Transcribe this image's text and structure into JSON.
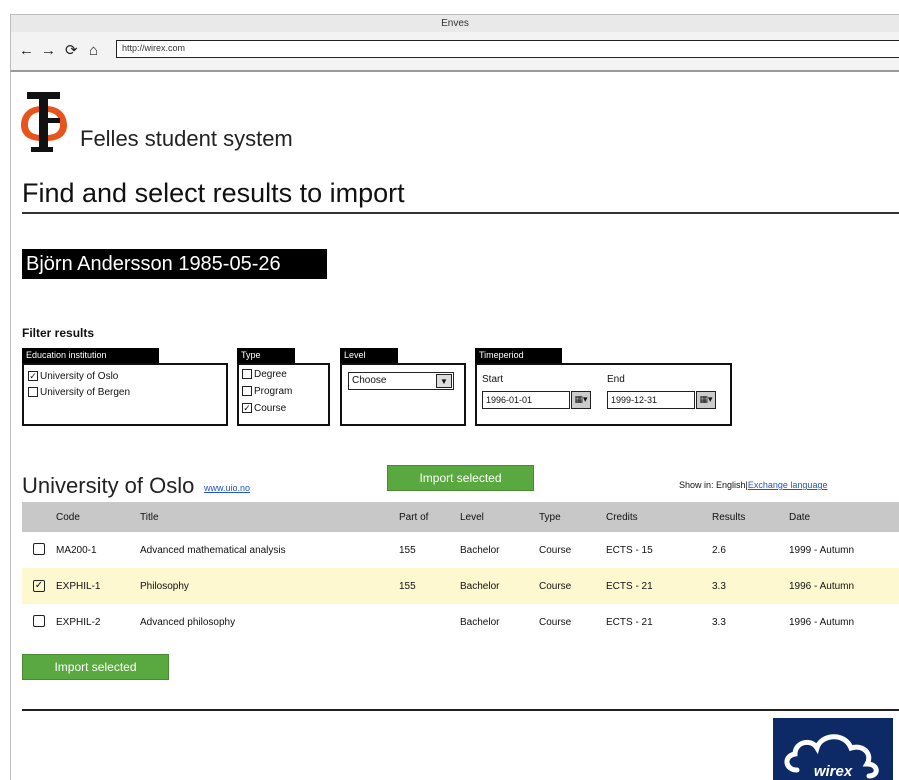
{
  "window": {
    "title": "Enves"
  },
  "browser": {
    "url": "http://wirex.com",
    "back": "←",
    "forward": "→",
    "reload": "⟳",
    "home": "⌂"
  },
  "header": {
    "app_name": "Felles student system",
    "page_title": "Find and select results to import",
    "student": "Björn Andersson 1985-05-26"
  },
  "filters": {
    "heading": "Filter results",
    "institution": {
      "label": "Education institution",
      "options": [
        {
          "label": "University of Oslo",
          "mark": "✓"
        },
        {
          "label": "University of Bergen",
          "mark": ""
        }
      ]
    },
    "type": {
      "label": "Type",
      "options": [
        {
          "label": "Degree",
          "mark": ""
        },
        {
          "label": "Program",
          "mark": ""
        },
        {
          "label": "Course",
          "mark": "✓"
        }
      ]
    },
    "level": {
      "label": "Level",
      "selected": "Choose",
      "arrow": "▼"
    },
    "timeperiod": {
      "label": "Timeperiod",
      "start_label": "Start",
      "start_value": "1996-01-01",
      "end_label": "End",
      "end_value": "1999-12-31",
      "spin": "▦▾"
    }
  },
  "results": {
    "institution_name": "University of Oslo",
    "institution_link": "www.uio.no",
    "import_label": "Import selected",
    "show_in_label": "Show in: English",
    "separator": "|",
    "exchange_link": "Exchange language",
    "columns": [
      "Code",
      "Title",
      "Part of",
      "Level",
      "Type",
      "Credits",
      "Results",
      "Date"
    ],
    "rows": [
      {
        "mark": "",
        "code": "MA200-1",
        "title": "Advanced mathematical analysis",
        "part_of": "155",
        "level": "Bachelor",
        "type": "Course",
        "credits": "ECTS - 15",
        "result": "2.6",
        "date": "1999 - Autumn"
      },
      {
        "mark": "✓",
        "code": "EXPHIL-1",
        "title": "Philosophy",
        "part_of": "155",
        "level": "Bachelor",
        "type": "Course",
        "credits": "ECTS - 21",
        "result": "3.3",
        "date": "1996 - Autumn"
      },
      {
        "mark": "",
        "code": "EXPHIL-2",
        "title": "Advanced philosophy",
        "part_of": "",
        "level": "Bachelor",
        "type": "Course",
        "credits": "ECTS - 21",
        "result": "3.3",
        "date": "1996 - Autumn"
      }
    ]
  },
  "footer": {
    "logo_text": "wirex"
  },
  "colors": {
    "accent_green": "#5aa840",
    "selected_row": "#fdf8d0",
    "link": "#2255cc",
    "logo_red": "#e8541e"
  }
}
